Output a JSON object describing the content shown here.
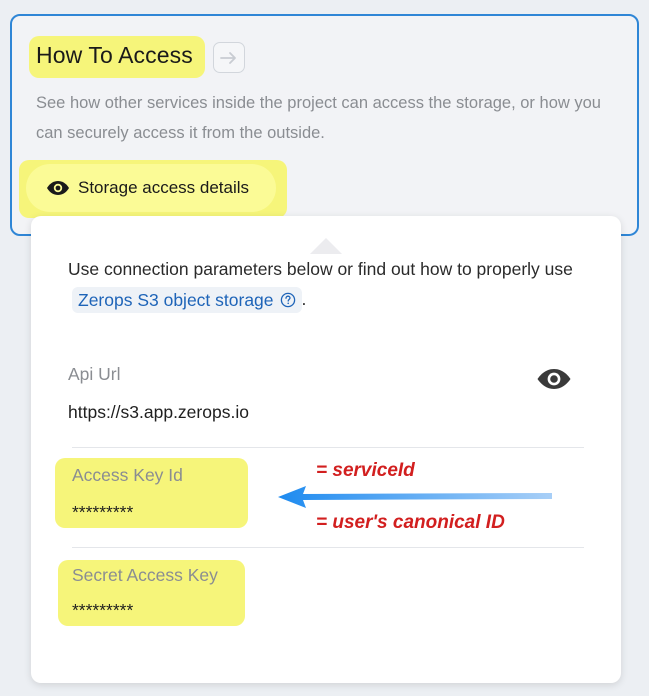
{
  "section": {
    "title": "How To Access",
    "description": "See how other services inside the project can access the storage, or how you can securely access it from the outside.",
    "details_button": "Storage access details"
  },
  "popup": {
    "intro_text": "Use connection parameters below or find out how to properly use",
    "link_text": "Zerops S3 object storage",
    "intro_suffix": ".",
    "fields": [
      {
        "label": "Api Url",
        "value": "https://s3.app.zerops.io"
      },
      {
        "label": "Access Key Id",
        "value": "*********"
      },
      {
        "label": "Secret Access Key",
        "value": "*********"
      }
    ]
  },
  "annotations": {
    "line1": "=  serviceId",
    "line2": "= user's canonical ID"
  },
  "colors": {
    "highlight": "#f6f57a",
    "accent_border": "#2f86d6",
    "link": "#1e64b8",
    "annotation": "#d21f1f",
    "arrow": "#1e8bf0"
  }
}
